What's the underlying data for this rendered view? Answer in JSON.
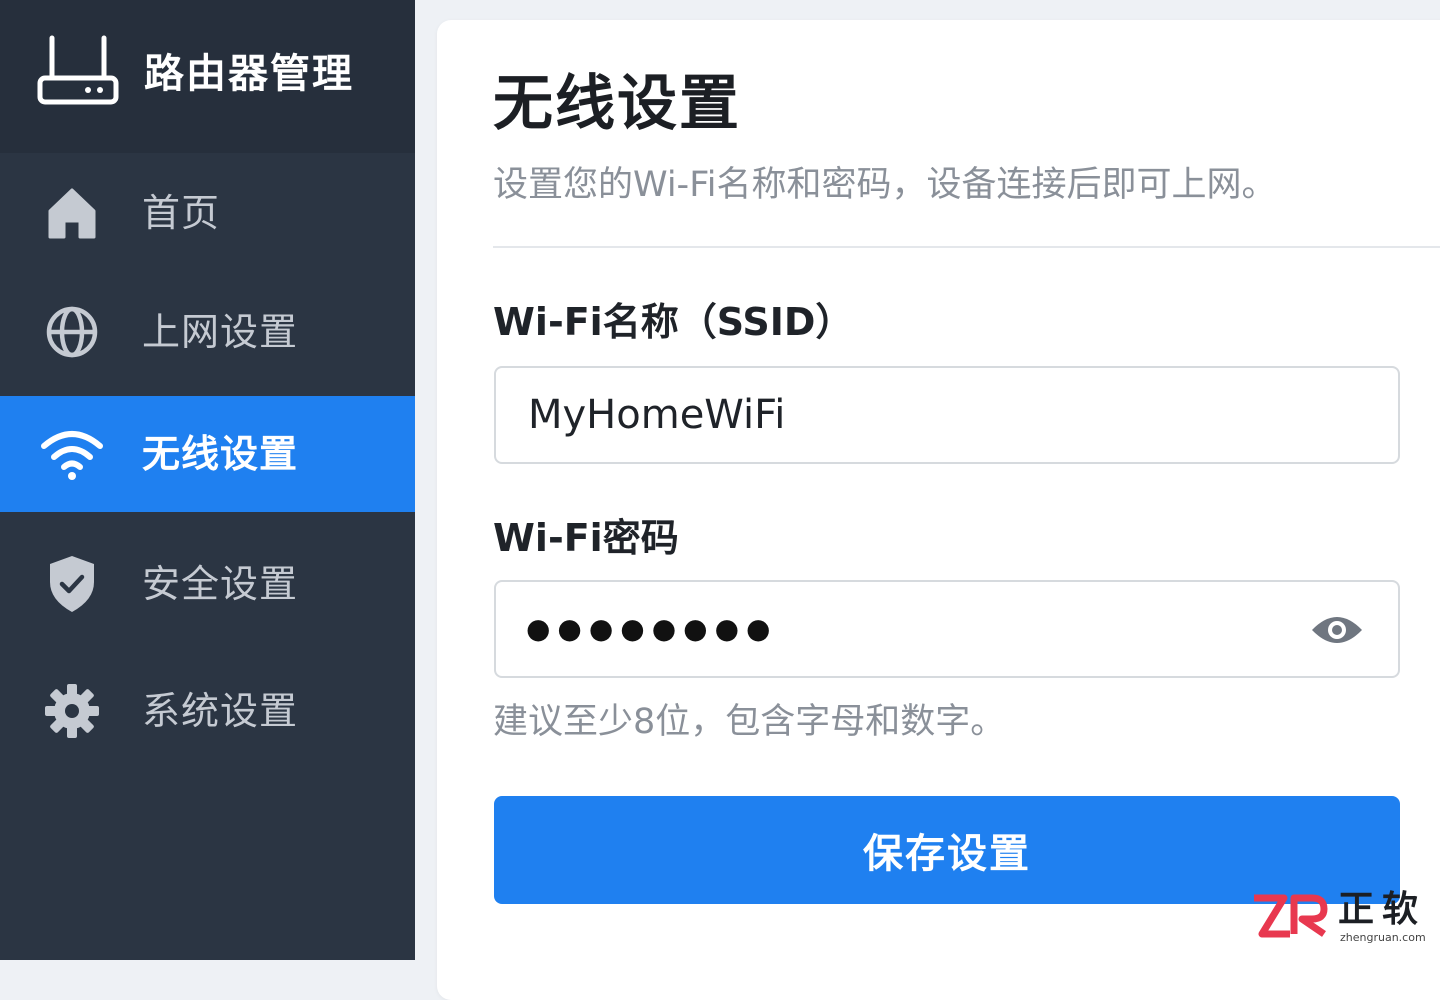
{
  "app": {
    "title": "路由器管理"
  },
  "sidebar": {
    "items": [
      {
        "label": "首页",
        "icon": "home-icon",
        "active": false
      },
      {
        "label": "上网设置",
        "icon": "globe-icon",
        "active": false
      },
      {
        "label": "无线设置",
        "icon": "wifi-icon",
        "active": true
      },
      {
        "label": "安全设置",
        "icon": "shield-check-icon",
        "active": false
      },
      {
        "label": "系统设置",
        "icon": "gear-icon",
        "active": false
      }
    ]
  },
  "main": {
    "title": "无线设置",
    "subtitle": "设置您的Wi-Fi名称和密码，设备连接后即可上网。",
    "ssid": {
      "label": "Wi-Fi名称（SSID）",
      "value": "MyHomeWiFi"
    },
    "password": {
      "label": "Wi-Fi密码",
      "masked_value": "●●●●●●●●",
      "hint": "建议至少8位，包含字母和数字。",
      "toggle_icon": "eye-icon"
    },
    "save_label": "保存设置"
  },
  "watermark": {
    "brand_cn": "正软",
    "url": "zhengruan.com"
  },
  "colors": {
    "sidebar_bg": "#2b3543",
    "brand_bg": "#262f3c",
    "accent": "#1f80f0",
    "page_bg": "#eef1f5"
  }
}
